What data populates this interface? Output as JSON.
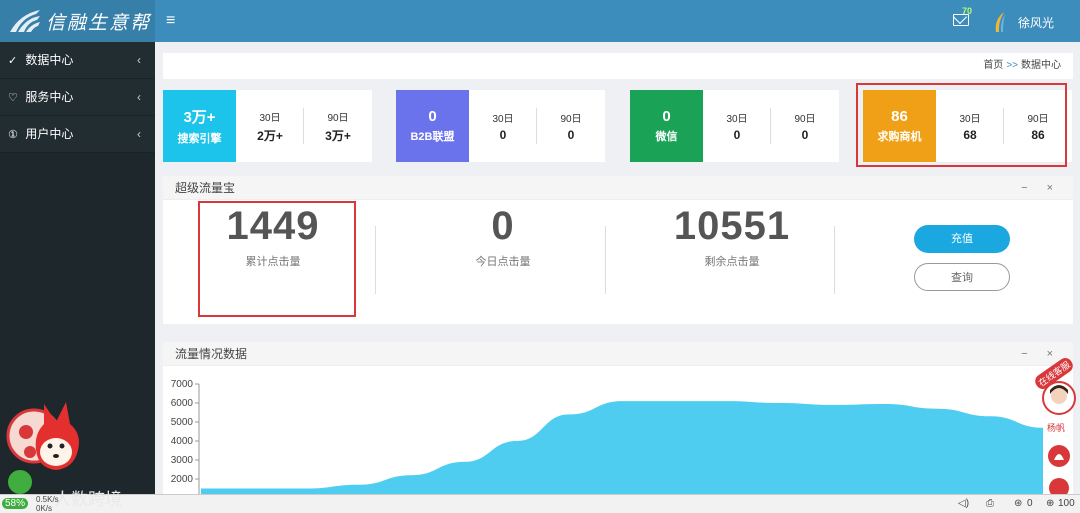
{
  "header": {
    "brand": "信融生意帮",
    "menu_toggle": "≡",
    "mail_count": "70",
    "user_name": "徐风光"
  },
  "sidebar": {
    "items": [
      {
        "icon": "✓",
        "label": "数据中心",
        "chevron": "‹"
      },
      {
        "icon": "♡",
        "label": "服务中心",
        "chevron": "‹"
      },
      {
        "icon": "①",
        "label": "用户中心",
        "chevron": "‹"
      }
    ]
  },
  "breadcrumb": {
    "home": "首页",
    "sep": ">>",
    "current": "数据中心"
  },
  "tiles": [
    {
      "value": "3万+",
      "label": "搜索引擎",
      "color": "#1cc4eb",
      "h1": "30日",
      "v1": "2万+",
      "h2": "90日",
      "v2": "3万+"
    },
    {
      "value": "0",
      "label": "B2B联盟",
      "color": "#6b73ec",
      "h1": "30日",
      "v1": "0",
      "h2": "90日",
      "v2": "0"
    },
    {
      "value": "0",
      "label": "微信",
      "color": "#1aa256",
      "h1": "30日",
      "v1": "0",
      "h2": "90日",
      "v2": "0"
    },
    {
      "value": "86",
      "label": "求购商机",
      "color": "#f0a016",
      "h1": "30日",
      "v1": "68",
      "h2": "90日",
      "v2": "86"
    }
  ],
  "traffic_panel": {
    "title": "超级流量宝",
    "tools": "− ×",
    "stats": [
      {
        "value": "1449",
        "label": "累计点击量"
      },
      {
        "value": "0",
        "label": "今日点击量"
      },
      {
        "value": "10551",
        "label": "剩余点击量"
      }
    ],
    "recharge_label": "充值",
    "query_label": "查询"
  },
  "chart_panel": {
    "title": "流量情况数据",
    "tools": "− ×"
  },
  "chart_data": {
    "type": "area",
    "y_ticks": [
      7000,
      6000,
      5000,
      4000,
      3000,
      2000
    ],
    "ylim": [
      1500,
      7000
    ],
    "color": "#4ecdf0",
    "x": [
      0,
      1,
      2,
      3,
      4,
      5,
      6,
      7,
      8,
      9,
      10,
      11,
      12,
      13,
      14,
      15,
      16
    ],
    "values": [
      1500,
      1500,
      1500,
      1700,
      2200,
      2900,
      4000,
      5400,
      6100,
      6100,
      6100,
      6000,
      5900,
      5950,
      5700,
      5300,
      4700
    ]
  },
  "float_widget": {
    "service_label": "在线客服",
    "agent_name": "杨帆"
  },
  "statusbar": {
    "percent": "58%",
    "net_up": "0.5K/s",
    "net_down": "0K/s",
    "watermark": "人数跨境",
    "zero_count": "0",
    "zoom": "100"
  }
}
